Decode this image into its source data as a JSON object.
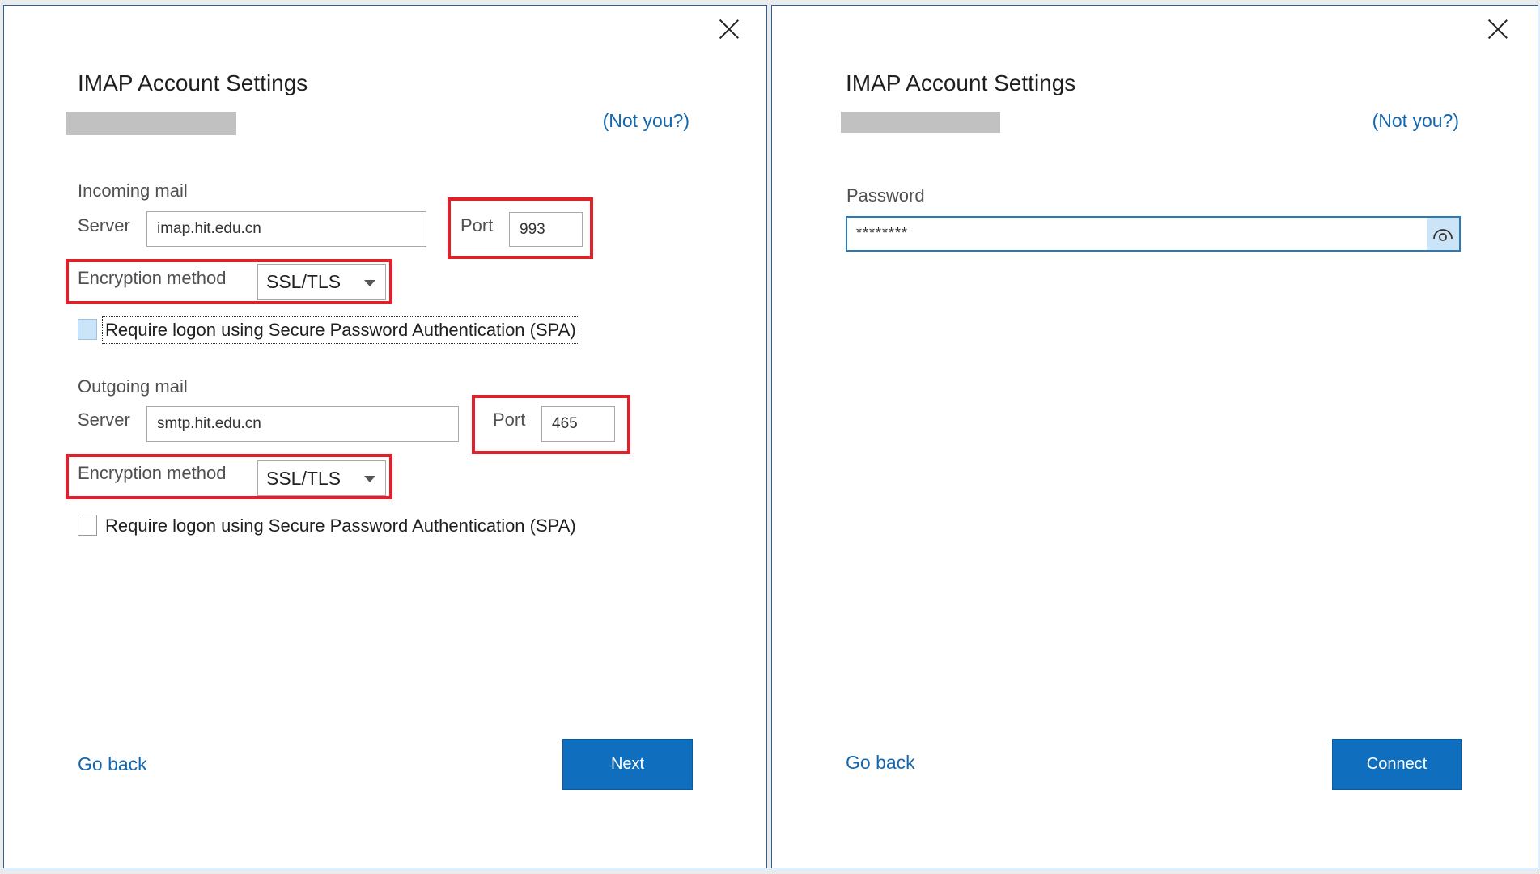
{
  "left_dialog": {
    "title": "IMAP Account Settings",
    "not_you": "(Not you?)",
    "incoming": {
      "heading": "Incoming mail",
      "server_label": "Server",
      "server_value": "imap.hit.edu.cn",
      "port_label": "Port",
      "port_value": "993",
      "encryption_label": "Encryption method",
      "encryption_value": "SSL/TLS",
      "spa_label": "Require logon using Secure Password Authentication (SPA)",
      "spa_checked": false
    },
    "outgoing": {
      "heading": "Outgoing mail",
      "server_label": "Server",
      "server_value": "smtp.hit.edu.cn",
      "port_label": "Port",
      "port_value": "465",
      "encryption_label": "Encryption method",
      "encryption_value": "SSL/TLS",
      "spa_label": "Require logon using Secure Password Authentication (SPA)",
      "spa_checked": false
    },
    "go_back": "Go back",
    "next": "Next"
  },
  "right_dialog": {
    "title": "IMAP Account Settings",
    "not_you": "(Not you?)",
    "password_label": "Password",
    "password_value": "********",
    "go_back": "Go back",
    "connect": "Connect"
  },
  "colors": {
    "accent": "#106ebe",
    "link": "#1468b0",
    "highlight": "#e0202a"
  },
  "icons": [
    "close-icon",
    "dropdown-caret-icon",
    "show-password-eye-icon"
  ]
}
